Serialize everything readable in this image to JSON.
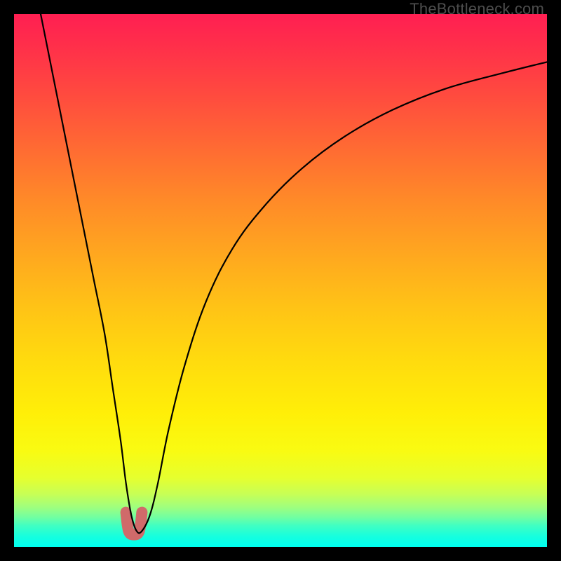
{
  "watermark": "TheBottleneck.com",
  "chart_data": {
    "type": "line",
    "title": "",
    "xlabel": "",
    "ylabel": "",
    "xlim": [
      0,
      100
    ],
    "ylim": [
      0,
      100
    ],
    "grid": false,
    "legend": false,
    "series": [
      {
        "name": "bottleneck-curve",
        "x": [
          5,
          7,
          9,
          11,
          13,
          15,
          17,
          18.5,
          20,
          21,
          22,
          23,
          24,
          25.5,
          27,
          29,
          32,
          36,
          41,
          47,
          54,
          62,
          71,
          81,
          92,
          100
        ],
        "values": [
          100,
          90,
          80,
          70,
          60,
          50,
          40,
          30,
          20,
          12,
          6,
          3,
          3,
          6,
          12,
          22,
          34,
          46,
          56,
          64,
          71,
          77,
          82,
          86,
          89,
          91
        ]
      },
      {
        "name": "minimum-highlight",
        "x": [
          21.0,
          21.5,
          22.5,
          23.5,
          24.0
        ],
        "values": [
          6.5,
          3.0,
          2.3,
          3.0,
          6.5
        ]
      }
    ],
    "colors": {
      "background_gradient_top": "#ff1f52",
      "background_gradient_mid": "#ffdb0e",
      "background_gradient_bottom": "#00fff0",
      "curve": "#000000",
      "highlight": "#d06a6a"
    }
  }
}
